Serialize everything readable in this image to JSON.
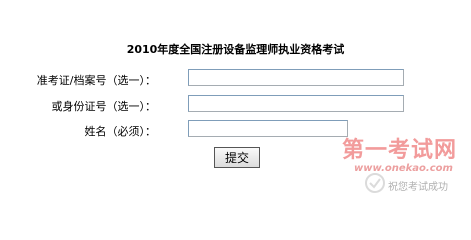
{
  "form": {
    "title": "2010年度全国注册设备监理师执业资格考试",
    "fields": [
      {
        "label": "准考证/档案号（选一）：",
        "value": ""
      },
      {
        "label": "或身份证号（选一）：",
        "value": ""
      },
      {
        "label": "姓名（必须）：",
        "value": ""
      }
    ],
    "submit_label": "提交"
  },
  "watermark": {
    "title": "第一考试网",
    "url": "www.onekao.com",
    "slogan": "祝您考试成功",
    "color": "#e84a4a"
  }
}
